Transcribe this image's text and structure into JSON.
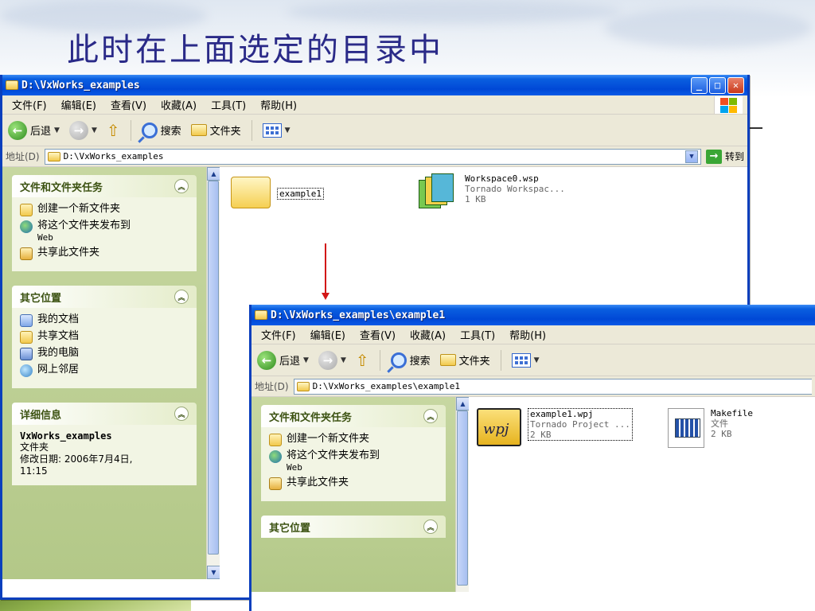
{
  "slide": {
    "title": "此时在上面选定的目录中"
  },
  "window1": {
    "title": "D:\\VxWorks_examples",
    "menu": [
      "文件(F)",
      "编辑(E)",
      "查看(V)",
      "收藏(A)",
      "工具(T)",
      "帮助(H)"
    ],
    "toolbar": {
      "back": "后退",
      "search": "搜索",
      "folders": "文件夹"
    },
    "address": {
      "label": "地址(D)",
      "value": "D:\\VxWorks_examples",
      "go": "转到"
    },
    "tasks": {
      "title": "文件和文件夹任务",
      "items": [
        "创建一个新文件夹",
        "将这个文件夹发布到",
        "Web",
        "共享此文件夹"
      ]
    },
    "places": {
      "title": "其它位置",
      "items": [
        "我的文档",
        "共享文档",
        "我的电脑",
        "网上邻居"
      ]
    },
    "details": {
      "title": "详细信息",
      "name": "VxWorks_examples",
      "type": "文件夹",
      "modified": "修改日期: 2006年7月4日,",
      "time": "11:15"
    },
    "files": [
      {
        "name": "example1"
      },
      {
        "name": "Workspace0.wsp",
        "type": "Tornado Workspac...",
        "size": "1 KB"
      }
    ]
  },
  "window2": {
    "title": "D:\\VxWorks_examples\\example1",
    "menu": [
      "文件(F)",
      "编辑(E)",
      "查看(V)",
      "收藏(A)",
      "工具(T)",
      "帮助(H)"
    ],
    "toolbar": {
      "back": "后退",
      "search": "搜索",
      "folders": "文件夹"
    },
    "address": {
      "label": "地址(D)",
      "value": "D:\\VxWorks_examples\\example1"
    },
    "tasks": {
      "title": "文件和文件夹任务",
      "items": [
        "创建一个新文件夹",
        "将这个文件夹发布到",
        "Web",
        "共享此文件夹"
      ]
    },
    "places": {
      "title": "其它位置"
    },
    "files": [
      {
        "name": "example1.wpj",
        "type": "Tornado Project ...",
        "size": "2 KB",
        "icon_text": "wpj"
      },
      {
        "name": "Makefile",
        "type": "文件",
        "size": "2 KB"
      }
    ]
  },
  "colors": {
    "titlebar": "#0054e3",
    "accent_arrow": "#d21616",
    "title_text": "#2a2a88"
  }
}
